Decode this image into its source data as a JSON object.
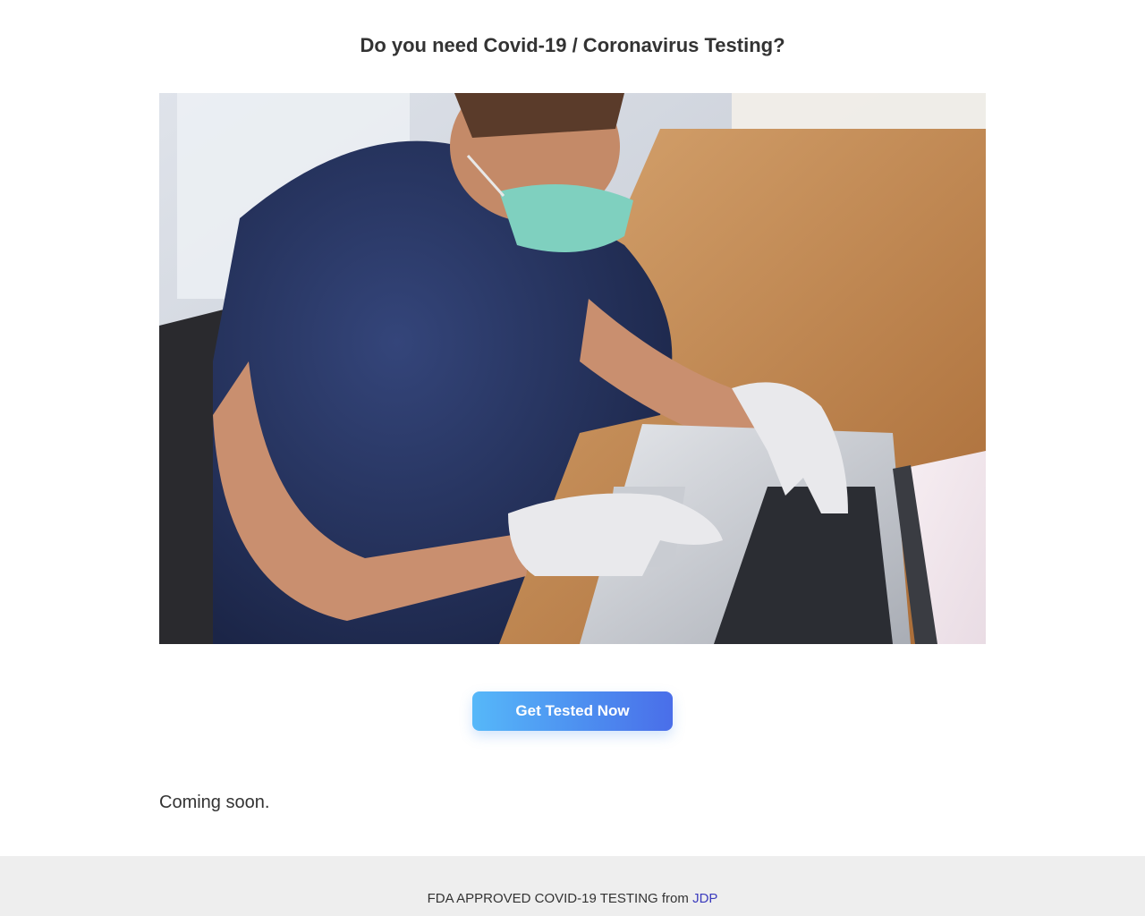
{
  "header": {
    "title": "Do you need Covid-19 / Coronavirus Testing?"
  },
  "hero": {
    "alt": "Man wearing a face mask and gloves typing on a laptop",
    "icon": "hero-photo"
  },
  "cta": {
    "label": "Get Tested Now"
  },
  "status": {
    "text": "Coming soon."
  },
  "footer": {
    "text": "FDA APPROVED COVID-19 TESTING from",
    "link_label": "JDP"
  },
  "colors": {
    "button_start": "#56b8f9",
    "button_end": "#4a6ee9",
    "footer_bg": "#eeeeee",
    "link": "#3b3bbd"
  }
}
